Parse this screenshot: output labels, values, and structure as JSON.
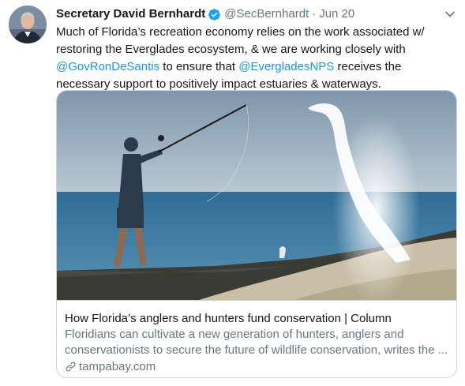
{
  "tweet": {
    "author_name": "Secretary David Bernhardt",
    "handle": "@SecBernhardt",
    "separator": "·",
    "date": "Jun 20",
    "text_part1": "Much of Florida’s recreation economy relies on the work associated w/ restoring the Everglades ecosystem, & we are working closely with ",
    "mention1": "@GovRonDeSantis",
    "text_part2": " to ensure that ",
    "mention2": "@EvergladesNPS",
    "text_part3": " receives the necessary support to positively impact estuaries & waterways."
  },
  "card": {
    "title": "How Florida’s anglers and hunters fund conservation | Column",
    "description": "Floridians can cultivate a new generation of hunters, anglers and conservationists to secure the future of wildlife conservation, writes the ...",
    "domain": "tampabay.com"
  },
  "icons": {
    "verified": "verified-badge-icon",
    "caret": "chevron-down-icon",
    "link": "link-icon"
  },
  "colors": {
    "mention": "#1b95e0",
    "secondary_text": "#657786",
    "border": "#ccd6dd",
    "verified": "#1da1f2"
  }
}
